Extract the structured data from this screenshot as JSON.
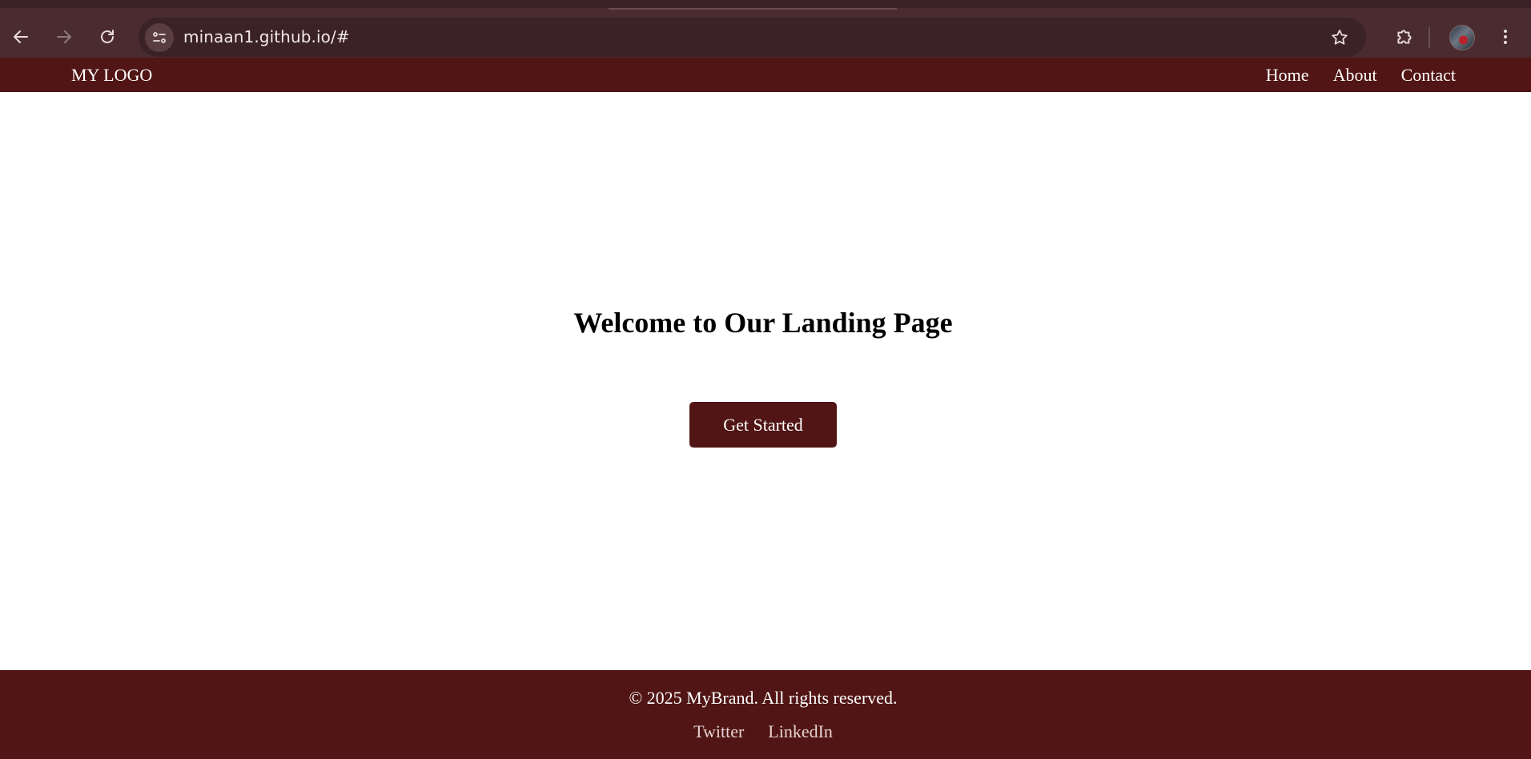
{
  "browser": {
    "url": "minaan1.github.io/#",
    "icons": {
      "back": "arrow-left-icon",
      "forward": "arrow-right-icon",
      "reload": "reload-icon",
      "site_info": "tune-icon",
      "bookmark": "star-icon",
      "extensions": "puzzle-icon",
      "menu": "kebab-menu-icon"
    }
  },
  "header": {
    "logo": "MY LOGO",
    "nav": [
      {
        "label": "Home"
      },
      {
        "label": "About"
      },
      {
        "label": "Contact"
      }
    ]
  },
  "hero": {
    "title": "Welcome to Our Landing Page",
    "cta_label": "Get Started"
  },
  "footer": {
    "copyright": "© 2025 MyBrand. All rights reserved.",
    "links": [
      {
        "label": "Twitter"
      },
      {
        "label": "LinkedIn"
      }
    ]
  },
  "colors": {
    "brand": "#501514",
    "chrome": "#4a2c30",
    "omnibox": "#3b2226"
  }
}
